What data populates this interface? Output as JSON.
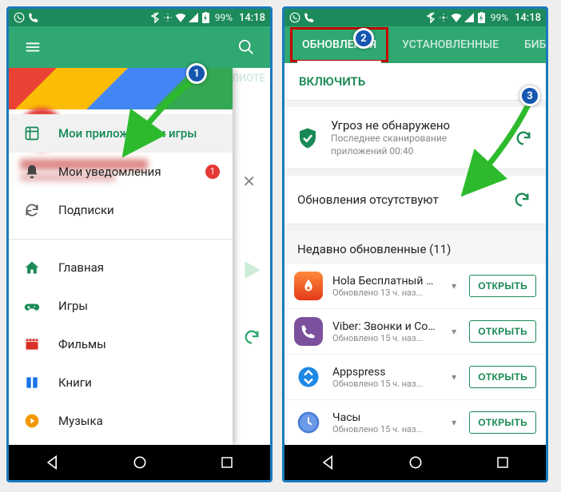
{
  "statusbar": {
    "battery": "99%",
    "time": "14:18"
  },
  "phone1": {
    "tabs": {
      "right_partial": "БИБЛИОТЕ"
    },
    "drawer": {
      "items": [
        {
          "label": "Мои приложения и игры",
          "icon": "apps"
        },
        {
          "label": "Мои уведомления",
          "icon": "bell",
          "badge": "1"
        },
        {
          "label": "Подписки",
          "icon": "refresh"
        }
      ],
      "items2": [
        {
          "label": "Главная",
          "icon": "home",
          "color": "#1a8a55"
        },
        {
          "label": "Игры",
          "icon": "gamepad",
          "color": "#1a8a55"
        },
        {
          "label": "Фильмы",
          "icon": "film",
          "color": "#d93025"
        },
        {
          "label": "Книги",
          "icon": "book",
          "color": "#1a73e8"
        },
        {
          "label": "Музыка",
          "icon": "music",
          "color": "#f29900"
        }
      ]
    }
  },
  "phone2": {
    "tabs": {
      "updates": "ОБНОВЛЕНИЯ",
      "installed": "УСТАНОВЛЕННЫЕ",
      "library": "БИБЛИОТЕК"
    },
    "enable": "ВКЛЮЧИТЬ",
    "scan": {
      "title": "Угроз не обнаружено",
      "subtitle": "Последнее сканирование приложений 00:40"
    },
    "no_updates": "Обновления отсутствуют",
    "recent_header": "Недавно обновленные (11)",
    "open_label": "ОТКРЫТЬ",
    "apps": [
      {
        "name": "Hola Бесплатный VPN",
        "sub": "Обновлено 13 ч. наз...",
        "color": "#f56b1f"
      },
      {
        "name": "Viber: Звонки и Сообщ...",
        "sub": "Обновлено 15 ч. наз...",
        "color": "#7b519d"
      },
      {
        "name": "Appspress",
        "sub": "Обновлено 15 ч. наз...",
        "color": "#1e88e5"
      },
      {
        "name": "Часы",
        "sub": "Обновлено 15 ч. наз...",
        "color": "#3a78d8"
      }
    ]
  },
  "bubbles": {
    "b1": "1",
    "b2": "2",
    "b3": "3"
  }
}
